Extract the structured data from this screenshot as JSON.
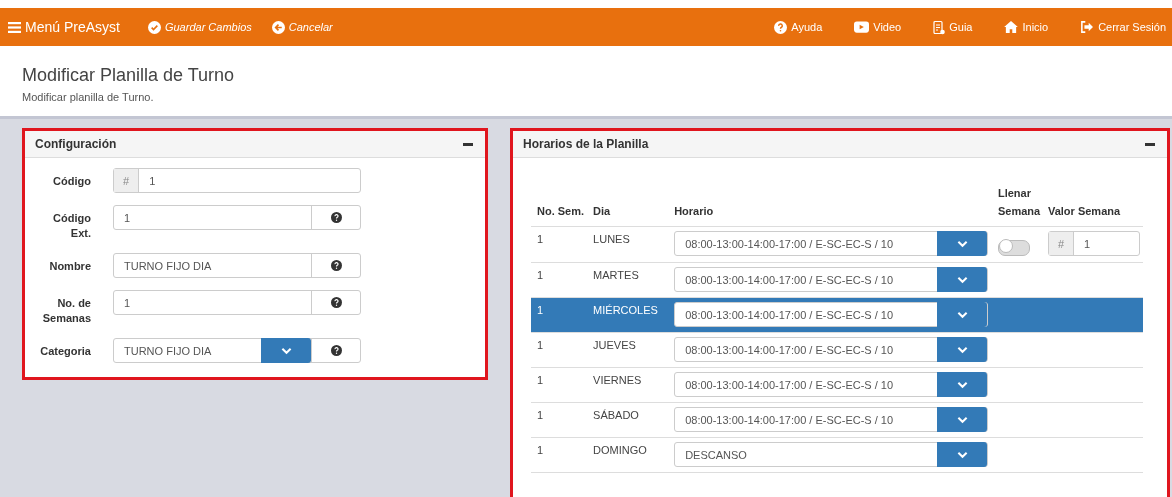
{
  "navbar": {
    "menu": "Menú PreAsyst",
    "actions": [
      "Guardar Cambios",
      "Cancelar"
    ],
    "links": [
      "Ayuda",
      "Video",
      "Guia",
      "Inicio",
      "Cerrar Sesión"
    ]
  },
  "header": {
    "title": "Modificar Planilla de Turno",
    "subtitle": "Modificar planilla de Turno."
  },
  "config": {
    "title": "Configuración",
    "fields": [
      {
        "label": "Código",
        "kind": "addon",
        "addon": "#",
        "value": "1"
      },
      {
        "label": "Código Ext.",
        "kind": "help",
        "value": "1"
      },
      {
        "label": "Nombre",
        "kind": "help",
        "value": "TURNO FIJO DIA"
      },
      {
        "label": "No. de Semanas",
        "kind": "help",
        "value": "1"
      },
      {
        "label": "Categoria",
        "kind": "select",
        "value": "TURNO FIJO DIA"
      }
    ]
  },
  "schedule": {
    "title": "Horarios de la Planilla",
    "columns": [
      "No. Sem.",
      "Dia",
      "Horario",
      "Llenar Semana",
      "Valor Semana"
    ],
    "rows": [
      {
        "week": "1",
        "day": "LUNES",
        "horario": "08:00-13:00-14:00-17:00 / E-SC-EC-S / 10",
        "selected": false,
        "fill_week": {
          "on": false
        },
        "week_value": {
          "addon": "#",
          "value": "1"
        }
      },
      {
        "week": "1",
        "day": "MARTES",
        "horario": "08:00-13:00-14:00-17:00 / E-SC-EC-S / 10",
        "selected": false
      },
      {
        "week": "1",
        "day": "MIÉRCOLES",
        "horario": "08:00-13:00-14:00-17:00 / E-SC-EC-S / 10",
        "selected": true
      },
      {
        "week": "1",
        "day": "JUEVES",
        "horario": "08:00-13:00-14:00-17:00 / E-SC-EC-S / 10",
        "selected": false
      },
      {
        "week": "1",
        "day": "VIERNES",
        "horario": "08:00-13:00-14:00-17:00 / E-SC-EC-S / 10",
        "selected": false
      },
      {
        "week": "1",
        "day": "SÁBADO",
        "horario": "08:00-13:00-14:00-17:00 / E-SC-EC-S / 10",
        "selected": false
      },
      {
        "week": "1",
        "day": "DOMINGO",
        "horario": "DESCANSO",
        "selected": false
      }
    ]
  }
}
